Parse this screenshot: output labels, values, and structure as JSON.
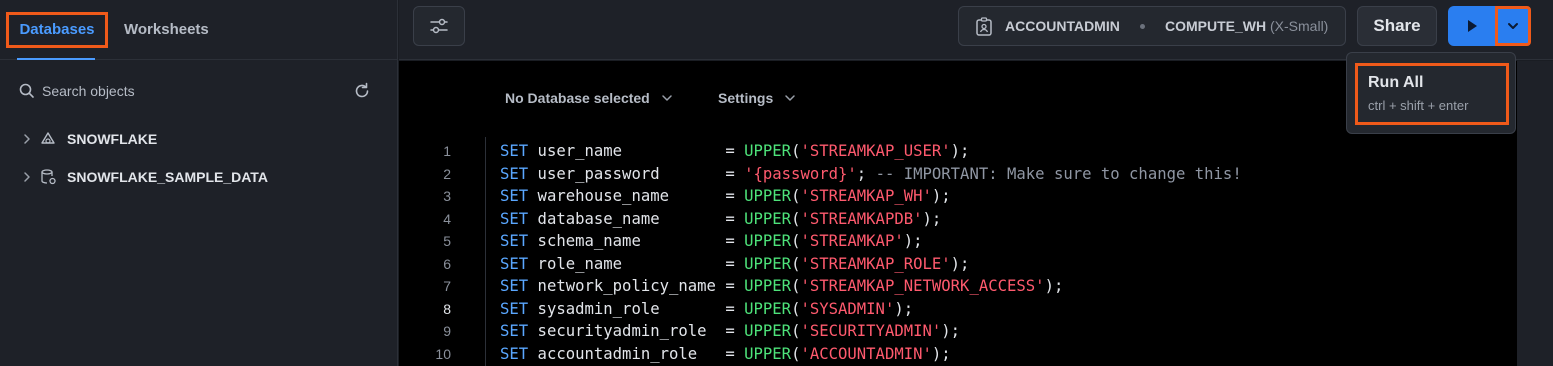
{
  "sidebar": {
    "tabs": [
      {
        "label": "Databases",
        "active": true
      },
      {
        "label": "Worksheets",
        "active": false
      }
    ],
    "search": {
      "placeholder": "Search objects"
    },
    "tree": [
      {
        "label": "SNOWFLAKE",
        "icon": "snowflake-db-icon"
      },
      {
        "label": "SNOWFLAKE_SAMPLE_DATA",
        "icon": "shared-db-icon"
      }
    ]
  },
  "toolbar": {
    "role": "ACCOUNTADMIN",
    "warehouse": "COMPUTE_WH",
    "warehouse_size": "(X-Small)",
    "share_label": "Share"
  },
  "editor": {
    "database_select": "No Database selected",
    "settings_label": "Settings",
    "active_line": 8,
    "lines": [
      {
        "n": "1",
        "kw": "SET",
        "var": " user_name           ",
        "eq": "= ",
        "fn": "UPPER",
        "open": "(",
        "str": "'STREAMKAP_USER'",
        "close": ");",
        "comment": ""
      },
      {
        "n": "2",
        "kw": "SET",
        "var": " user_password       ",
        "eq": "= ",
        "fn": "",
        "open": "",
        "str": "'{password}'",
        "close": "; ",
        "comment": "-- IMPORTANT: Make sure to change this!"
      },
      {
        "n": "3",
        "kw": "SET",
        "var": " warehouse_name      ",
        "eq": "= ",
        "fn": "UPPER",
        "open": "(",
        "str": "'STREAMKAP_WH'",
        "close": ");",
        "comment": ""
      },
      {
        "n": "4",
        "kw": "SET",
        "var": " database_name       ",
        "eq": "= ",
        "fn": "UPPER",
        "open": "(",
        "str": "'STREAMKAPDB'",
        "close": ");",
        "comment": ""
      },
      {
        "n": "5",
        "kw": "SET",
        "var": " schema_name         ",
        "eq": "= ",
        "fn": "UPPER",
        "open": "(",
        "str": "'STREAMKAP'",
        "close": ");",
        "comment": ""
      },
      {
        "n": "6",
        "kw": "SET",
        "var": " role_name           ",
        "eq": "= ",
        "fn": "UPPER",
        "open": "(",
        "str": "'STREAMKAP_ROLE'",
        "close": ");",
        "comment": ""
      },
      {
        "n": "7",
        "kw": "SET",
        "var": " network_policy_name ",
        "eq": "= ",
        "fn": "UPPER",
        "open": "(",
        "str": "'STREAMKAP_NETWORK_ACCESS'",
        "close": ");",
        "comment": ""
      },
      {
        "n": "8",
        "kw": "SET",
        "var": " sysadmin_role       ",
        "eq": "= ",
        "fn": "UPPER",
        "open": "(",
        "str": "'SYSADMIN'",
        "close": ");",
        "comment": ""
      },
      {
        "n": "9",
        "kw": "SET",
        "var": " securityadmin_role  ",
        "eq": "= ",
        "fn": "UPPER",
        "open": "(",
        "str": "'SECURITYADMIN'",
        "close": ");",
        "comment": ""
      },
      {
        "n": "10",
        "kw": "SET",
        "var": " accountadmin_role   ",
        "eq": "= ",
        "fn": "UPPER",
        "open": "(",
        "str": "'ACCOUNTADMIN'",
        "close": ");",
        "comment": ""
      }
    ]
  },
  "run_menu": {
    "item_label": "Run All",
    "shortcut": "ctrl + shift + enter"
  },
  "colors": {
    "accent": "#2a7ef0",
    "highlight": "#f05a1a",
    "keyword": "#5aa7ff",
    "function": "#4ee37a",
    "string": "#ff5a6e"
  }
}
